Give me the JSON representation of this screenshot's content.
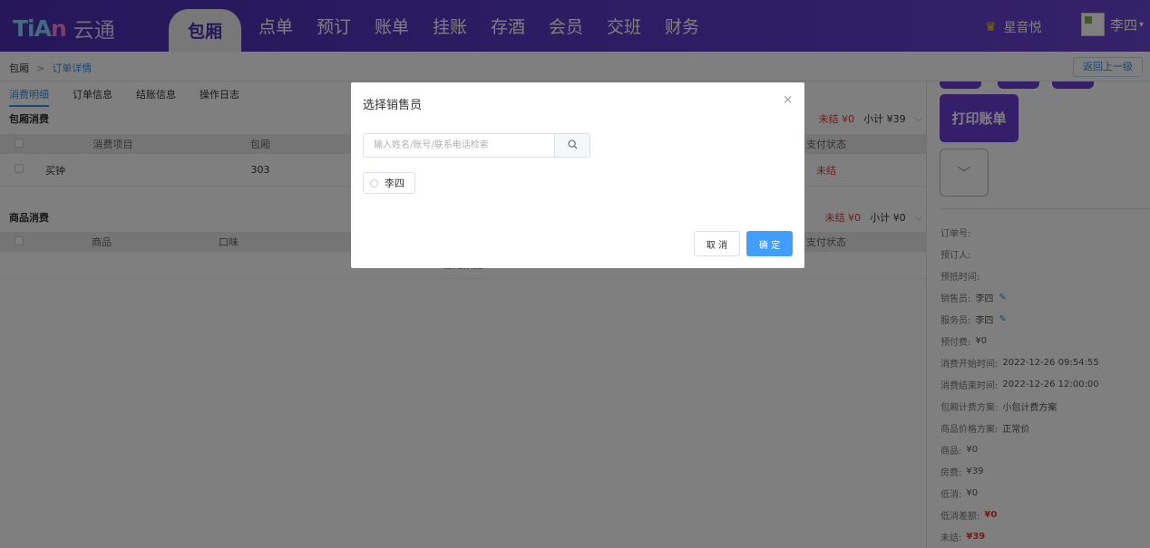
{
  "header": {
    "logo_mark_a": "TiA",
    "logo_mark_b": "n",
    "logo_text": "云通",
    "nav": [
      {
        "label": "包厢",
        "active": true
      },
      {
        "label": "点单"
      },
      {
        "label": "预订"
      },
      {
        "label": "账单"
      },
      {
        "label": "挂账"
      },
      {
        "label": "存酒"
      },
      {
        "label": "会员"
      },
      {
        "label": "交班"
      },
      {
        "label": "财务"
      }
    ],
    "store_icon": "crown-icon",
    "store_name": "星音悦",
    "user_name": "李四"
  },
  "breadcrumb": {
    "root": "包厢",
    "separator": ">",
    "current": "订单详情",
    "back_label": "返回上一级"
  },
  "main": {
    "tabs": [
      "消费明细",
      "订单信息",
      "结账信息",
      "操作日志"
    ],
    "room_section": {
      "title": "包厢消费",
      "unpaid": "未结 ¥0",
      "subtotal": "小计 ¥39",
      "columns": [
        "消费项目",
        "包厢",
        "支付状态"
      ],
      "rows": [
        {
          "item": "买钟",
          "room": "303",
          "status": "未结"
        }
      ]
    },
    "goods_section": {
      "title": "商品消费",
      "unpaid": "未结 ¥0",
      "subtotal": "小计 ¥0",
      "columns": [
        "商品",
        "口味",
        "支付状态"
      ],
      "empty_text": "暂无数据"
    }
  },
  "side": {
    "print_label": "打印账单",
    "info": [
      {
        "k": "订单号:",
        "v": ""
      },
      {
        "k": "预订人:",
        "v": ""
      },
      {
        "k": "预抵时间:",
        "v": ""
      },
      {
        "k": "销售员:",
        "v": "李四",
        "editable": true
      },
      {
        "k": "服务员:",
        "v": "李四",
        "editable": true
      },
      {
        "k": "预付费:",
        "v": "¥0"
      },
      {
        "k": "消费开始时间:",
        "v": "2022-12-26 09:54:55"
      },
      {
        "k": "消费结束时间:",
        "v": "2022-12-26 12:00:00"
      },
      {
        "k": "包厢计费方案:",
        "v": "小包计费方案"
      },
      {
        "k": "商品价格方案:",
        "v": "正常价"
      },
      {
        "k": "商品:",
        "v": "¥0"
      },
      {
        "k": "房费:",
        "v": "¥39"
      },
      {
        "k": "低消:",
        "v": "¥0"
      },
      {
        "k": "低消差额:",
        "v": "¥0",
        "red": true
      },
      {
        "k": "未结:",
        "v": "¥39",
        "red": true
      }
    ]
  },
  "dialog": {
    "title": "选择销售员",
    "close_glyph": "×",
    "search_placeholder": "输入姓名/账号/联系电话检索",
    "search_value": "",
    "options": [
      "李四"
    ],
    "cancel_label": "取 消",
    "confirm_label": "确 定"
  },
  "colors": {
    "brand": "#5a39c6",
    "accent": "#409eff",
    "danger": "#e53935"
  }
}
